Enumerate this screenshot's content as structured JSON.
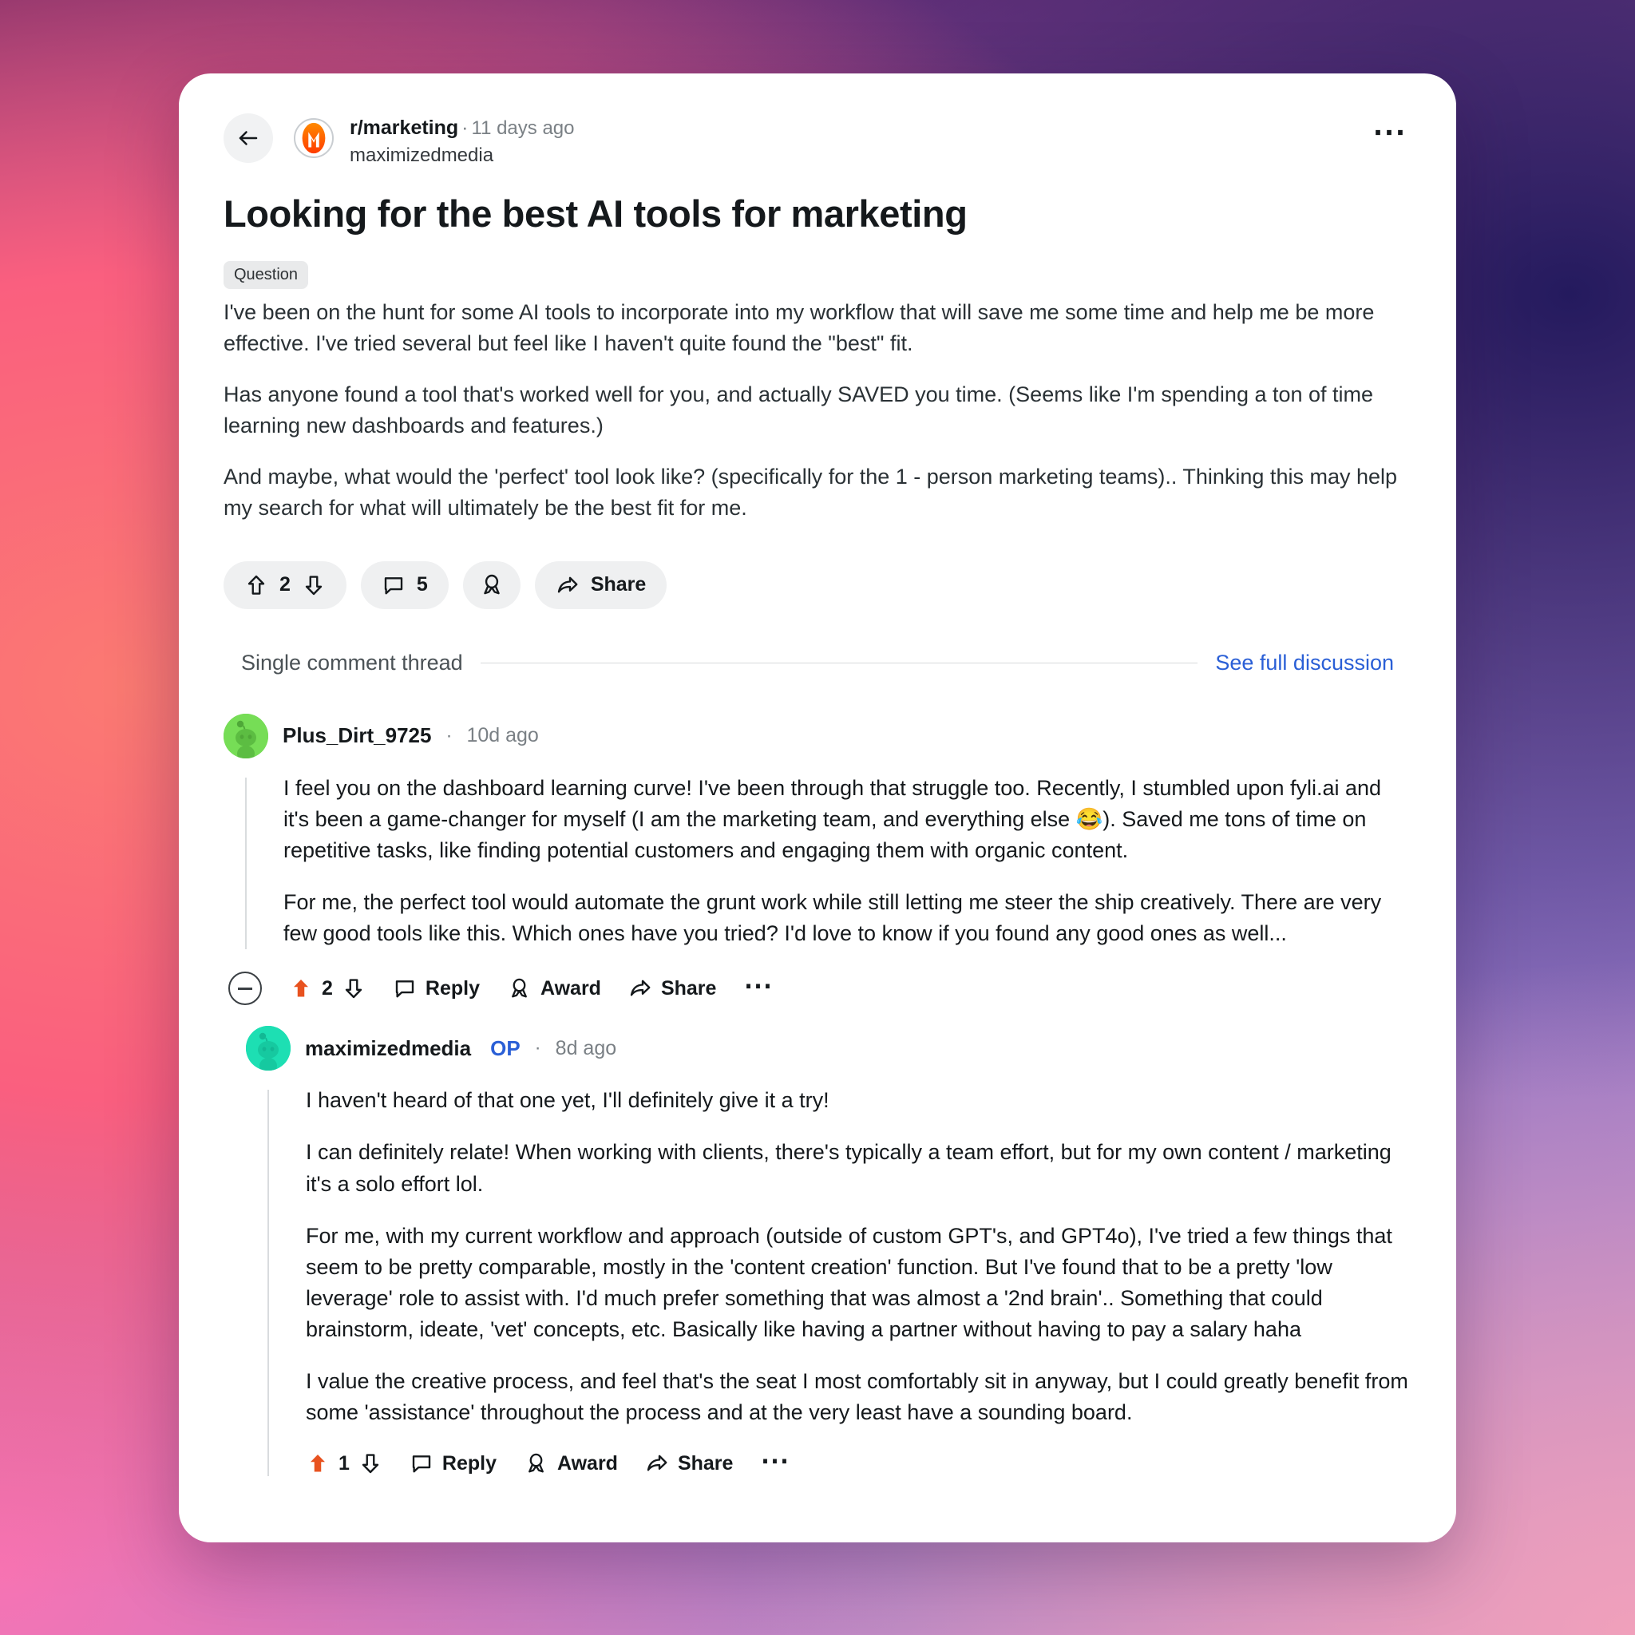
{
  "post": {
    "back_icon": "back-arrow-icon",
    "subreddit": "r/marketing",
    "separator": "·",
    "age": "11 days ago",
    "author": "maximizedmedia",
    "overflow_icon": "more-options-icon",
    "title": "Looking for the best AI tools for marketing",
    "flair": "Question",
    "paragraphs": [
      "I've been on the hunt for some AI tools to incorporate into my workflow that will save me some time and help me be more effective. I've tried several but feel like I haven't quite found the \"best\" fit.",
      "Has anyone found a tool that's worked well for you, and actually SAVED you time. (Seems like I'm spending a ton of time learning new dashboards and features.)",
      "And maybe, what would the 'perfect' tool look like? (specifically for the 1 - person marketing teams).. Thinking this may help my search for what will ultimately be the best fit for me."
    ],
    "actions": {
      "upvote_icon": "upvote-arrow-icon",
      "vote_count": "2",
      "downvote_icon": "downvote-arrow-icon",
      "comment_icon": "comment-bubble-icon",
      "comment_count": "5",
      "award_icon": "award-medal-icon",
      "share_icon": "share-arrow-icon",
      "share_label": "Share"
    }
  },
  "thread_bar": {
    "label": "Single comment thread",
    "link": "See full discussion"
  },
  "comments": [
    {
      "avatar_icon": "reddit-snoo-avatar-green",
      "username": "Plus_Dirt_9725",
      "separator": "·",
      "age": "10d ago",
      "paragraphs": [
        "I feel you on the dashboard learning curve! I've been through that struggle too. Recently, I stumbled upon fyli.ai and it's been a game-changer for myself (I am the marketing team, and everything else 😂). Saved me tons of time on repetitive tasks, like finding potential customers and engaging them with organic content.",
        "For me, the perfect tool would automate the grunt work while still letting me steer the ship creatively. There are very few good tools like this. Which ones have you tried? I'd love to know if you found any good ones as well..."
      ],
      "actions": {
        "collapse_icon": "collapse-thread-icon",
        "upvote_icon": "upvote-arrow-filled-icon",
        "vote_count": "2",
        "downvote_icon": "downvote-arrow-icon",
        "reply_icon": "comment-bubble-icon",
        "reply_label": "Reply",
        "award_icon": "award-medal-icon",
        "award_label": "Award",
        "share_icon": "share-arrow-icon",
        "share_label": "Share",
        "overflow_icon": "more-options-icon"
      }
    },
    {
      "avatar_icon": "reddit-snoo-avatar-teal",
      "username": "maximizedmedia",
      "op_badge": "OP",
      "separator": "·",
      "age": "8d ago",
      "paragraphs": [
        "I haven't heard of that one yet, I'll definitely give it a try!",
        "I can definitely relate! When working with clients, there's typically a team effort, but for my own content / marketing it's a solo effort lol.",
        "For me, with my current workflow and approach (outside of custom GPT's, and GPT4o), I've tried a few things that seem to be pretty comparable, mostly in the 'content creation' function. But I've found that to be a pretty 'low leverage' role to assist with. I'd much prefer something that was almost a '2nd brain'.. Something that could brainstorm, ideate, 'vet' concepts, etc. Basically like having a partner without having to pay a salary haha",
        "I value the creative process, and feel that's the seat I most comfortably sit in anyway, but I could greatly benefit from some 'assistance' throughout the process and at the very least have a sounding board."
      ],
      "actions": {
        "upvote_icon": "upvote-arrow-filled-icon",
        "vote_count": "1",
        "downvote_icon": "downvote-arrow-icon",
        "reply_icon": "comment-bubble-icon",
        "reply_label": "Reply",
        "award_icon": "award-medal-icon",
        "award_label": "Award",
        "share_icon": "share-arrow-icon",
        "share_label": "Share",
        "overflow_icon": "more-options-icon"
      }
    }
  ],
  "colors": {
    "upvote_active": "#e8521f",
    "link": "#2a5fd6",
    "card_bg": "#ffffff",
    "pill_bg": "#eff0f1"
  }
}
